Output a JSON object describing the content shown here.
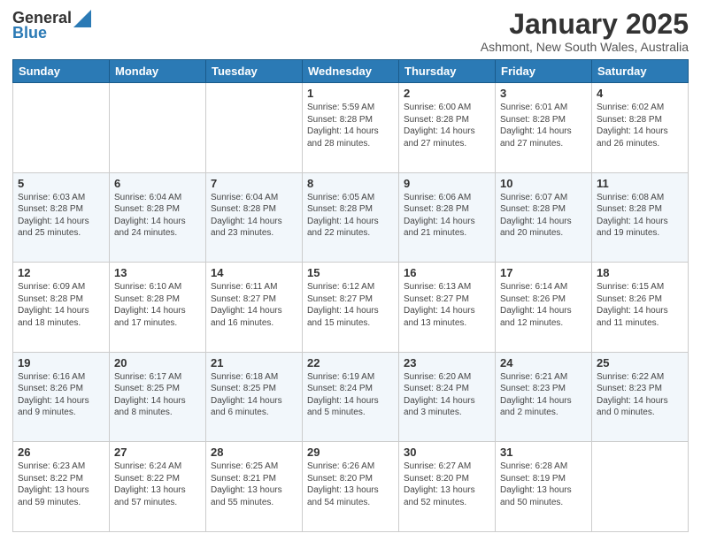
{
  "header": {
    "logo_general": "General",
    "logo_blue": "Blue",
    "month_title": "January 2025",
    "subtitle": "Ashmont, New South Wales, Australia"
  },
  "days_of_week": [
    "Sunday",
    "Monday",
    "Tuesday",
    "Wednesday",
    "Thursday",
    "Friday",
    "Saturday"
  ],
  "weeks": [
    [
      {
        "day": "",
        "sunrise": "",
        "sunset": "",
        "daylight": ""
      },
      {
        "day": "",
        "sunrise": "",
        "sunset": "",
        "daylight": ""
      },
      {
        "day": "",
        "sunrise": "",
        "sunset": "",
        "daylight": ""
      },
      {
        "day": "1",
        "sunrise": "Sunrise: 5:59 AM",
        "sunset": "Sunset: 8:28 PM",
        "daylight": "Daylight: 14 hours and 28 minutes."
      },
      {
        "day": "2",
        "sunrise": "Sunrise: 6:00 AM",
        "sunset": "Sunset: 8:28 PM",
        "daylight": "Daylight: 14 hours and 27 minutes."
      },
      {
        "day": "3",
        "sunrise": "Sunrise: 6:01 AM",
        "sunset": "Sunset: 8:28 PM",
        "daylight": "Daylight: 14 hours and 27 minutes."
      },
      {
        "day": "4",
        "sunrise": "Sunrise: 6:02 AM",
        "sunset": "Sunset: 8:28 PM",
        "daylight": "Daylight: 14 hours and 26 minutes."
      }
    ],
    [
      {
        "day": "5",
        "sunrise": "Sunrise: 6:03 AM",
        "sunset": "Sunset: 8:28 PM",
        "daylight": "Daylight: 14 hours and 25 minutes."
      },
      {
        "day": "6",
        "sunrise": "Sunrise: 6:04 AM",
        "sunset": "Sunset: 8:28 PM",
        "daylight": "Daylight: 14 hours and 24 minutes."
      },
      {
        "day": "7",
        "sunrise": "Sunrise: 6:04 AM",
        "sunset": "Sunset: 8:28 PM",
        "daylight": "Daylight: 14 hours and 23 minutes."
      },
      {
        "day": "8",
        "sunrise": "Sunrise: 6:05 AM",
        "sunset": "Sunset: 8:28 PM",
        "daylight": "Daylight: 14 hours and 22 minutes."
      },
      {
        "day": "9",
        "sunrise": "Sunrise: 6:06 AM",
        "sunset": "Sunset: 8:28 PM",
        "daylight": "Daylight: 14 hours and 21 minutes."
      },
      {
        "day": "10",
        "sunrise": "Sunrise: 6:07 AM",
        "sunset": "Sunset: 8:28 PM",
        "daylight": "Daylight: 14 hours and 20 minutes."
      },
      {
        "day": "11",
        "sunrise": "Sunrise: 6:08 AM",
        "sunset": "Sunset: 8:28 PM",
        "daylight": "Daylight: 14 hours and 19 minutes."
      }
    ],
    [
      {
        "day": "12",
        "sunrise": "Sunrise: 6:09 AM",
        "sunset": "Sunset: 8:28 PM",
        "daylight": "Daylight: 14 hours and 18 minutes."
      },
      {
        "day": "13",
        "sunrise": "Sunrise: 6:10 AM",
        "sunset": "Sunset: 8:28 PM",
        "daylight": "Daylight: 14 hours and 17 minutes."
      },
      {
        "day": "14",
        "sunrise": "Sunrise: 6:11 AM",
        "sunset": "Sunset: 8:27 PM",
        "daylight": "Daylight: 14 hours and 16 minutes."
      },
      {
        "day": "15",
        "sunrise": "Sunrise: 6:12 AM",
        "sunset": "Sunset: 8:27 PM",
        "daylight": "Daylight: 14 hours and 15 minutes."
      },
      {
        "day": "16",
        "sunrise": "Sunrise: 6:13 AM",
        "sunset": "Sunset: 8:27 PM",
        "daylight": "Daylight: 14 hours and 13 minutes."
      },
      {
        "day": "17",
        "sunrise": "Sunrise: 6:14 AM",
        "sunset": "Sunset: 8:26 PM",
        "daylight": "Daylight: 14 hours and 12 minutes."
      },
      {
        "day": "18",
        "sunrise": "Sunrise: 6:15 AM",
        "sunset": "Sunset: 8:26 PM",
        "daylight": "Daylight: 14 hours and 11 minutes."
      }
    ],
    [
      {
        "day": "19",
        "sunrise": "Sunrise: 6:16 AM",
        "sunset": "Sunset: 8:26 PM",
        "daylight": "Daylight: 14 hours and 9 minutes."
      },
      {
        "day": "20",
        "sunrise": "Sunrise: 6:17 AM",
        "sunset": "Sunset: 8:25 PM",
        "daylight": "Daylight: 14 hours and 8 minutes."
      },
      {
        "day": "21",
        "sunrise": "Sunrise: 6:18 AM",
        "sunset": "Sunset: 8:25 PM",
        "daylight": "Daylight: 14 hours and 6 minutes."
      },
      {
        "day": "22",
        "sunrise": "Sunrise: 6:19 AM",
        "sunset": "Sunset: 8:24 PM",
        "daylight": "Daylight: 14 hours and 5 minutes."
      },
      {
        "day": "23",
        "sunrise": "Sunrise: 6:20 AM",
        "sunset": "Sunset: 8:24 PM",
        "daylight": "Daylight: 14 hours and 3 minutes."
      },
      {
        "day": "24",
        "sunrise": "Sunrise: 6:21 AM",
        "sunset": "Sunset: 8:23 PM",
        "daylight": "Daylight: 14 hours and 2 minutes."
      },
      {
        "day": "25",
        "sunrise": "Sunrise: 6:22 AM",
        "sunset": "Sunset: 8:23 PM",
        "daylight": "Daylight: 14 hours and 0 minutes."
      }
    ],
    [
      {
        "day": "26",
        "sunrise": "Sunrise: 6:23 AM",
        "sunset": "Sunset: 8:22 PM",
        "daylight": "Daylight: 13 hours and 59 minutes."
      },
      {
        "day": "27",
        "sunrise": "Sunrise: 6:24 AM",
        "sunset": "Sunset: 8:22 PM",
        "daylight": "Daylight: 13 hours and 57 minutes."
      },
      {
        "day": "28",
        "sunrise": "Sunrise: 6:25 AM",
        "sunset": "Sunset: 8:21 PM",
        "daylight": "Daylight: 13 hours and 55 minutes."
      },
      {
        "day": "29",
        "sunrise": "Sunrise: 6:26 AM",
        "sunset": "Sunset: 8:20 PM",
        "daylight": "Daylight: 13 hours and 54 minutes."
      },
      {
        "day": "30",
        "sunrise": "Sunrise: 6:27 AM",
        "sunset": "Sunset: 8:20 PM",
        "daylight": "Daylight: 13 hours and 52 minutes."
      },
      {
        "day": "31",
        "sunrise": "Sunrise: 6:28 AM",
        "sunset": "Sunset: 8:19 PM",
        "daylight": "Daylight: 13 hours and 50 minutes."
      },
      {
        "day": "",
        "sunrise": "",
        "sunset": "",
        "daylight": ""
      }
    ]
  ]
}
